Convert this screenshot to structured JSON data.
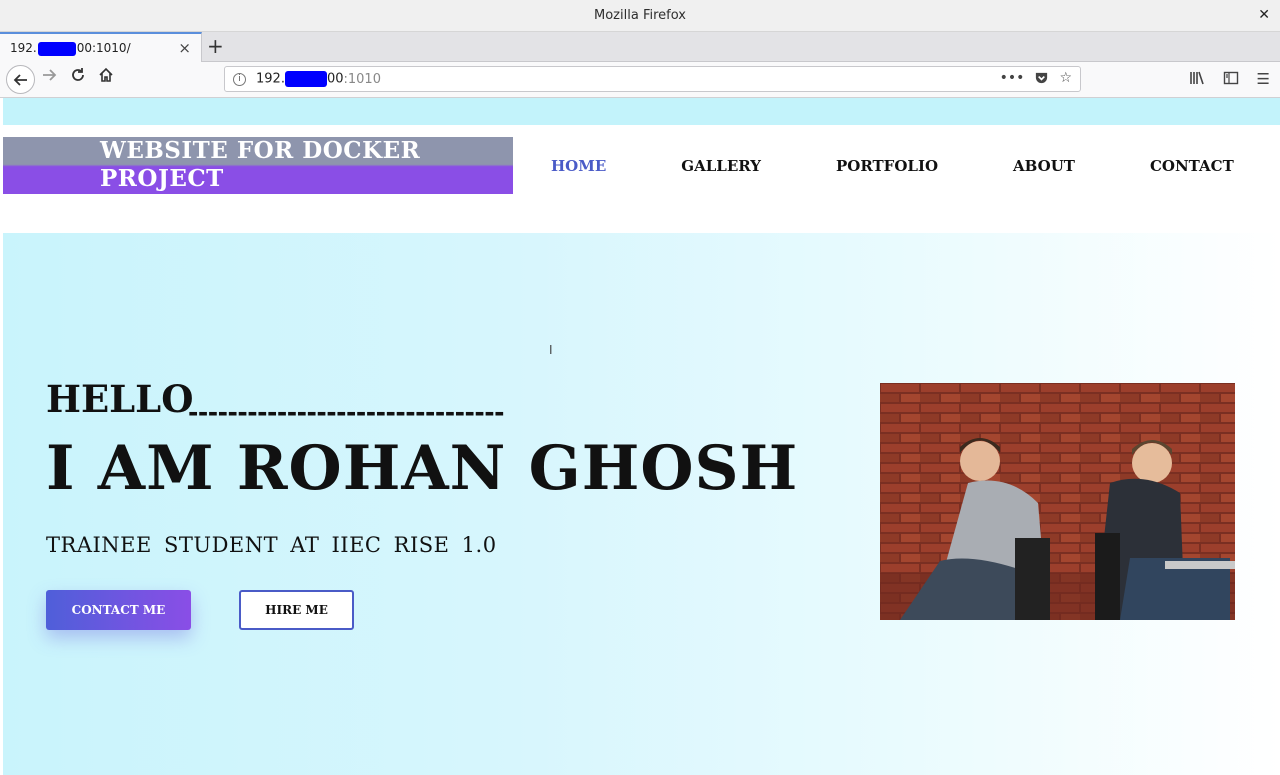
{
  "window": {
    "title": "Mozilla Firefox"
  },
  "tab": {
    "title_prefix": "192.",
    "title_suffix": "00:1010/"
  },
  "urlbar": {
    "host_prefix": "192.",
    "host_suffix": "00",
    "port": ":1010"
  },
  "site": {
    "logo_line1": "WEBSITE FOR DOCKER",
    "logo_line2": "PROJECT",
    "menu": [
      {
        "label": "HOME",
        "active": true
      },
      {
        "label": "GALLERY",
        "active": false
      },
      {
        "label": "PORTFOLIO",
        "active": false
      },
      {
        "label": "ABOUT",
        "active": false
      },
      {
        "label": "CONTACT",
        "active": false
      }
    ]
  },
  "hero": {
    "greeting": "HELLO",
    "dashes": "--------------------------------",
    "name": "I AM ROHAN GHOSH",
    "subtitle": "TRAINEE STUDENT AT IIEC RISE 1.0",
    "contact_button": "CONTACT ME",
    "hire_button": "HIRE ME"
  },
  "colors": {
    "accent": "#4a5bc7",
    "gradient_start": "#4f5fd9",
    "gradient_end": "#8a4ee6",
    "hero_bg": "#c9f4fc"
  },
  "icons": {
    "close": "close-icon",
    "new_tab": "plus-icon",
    "back": "back-arrow-icon",
    "forward": "forward-arrow-icon",
    "reload": "reload-icon",
    "home": "home-icon",
    "info": "info-icon",
    "more": "more-icon",
    "pocket": "pocket-icon",
    "bookmark": "star-icon",
    "library": "library-icon",
    "sidebar": "sidebar-icon",
    "menu": "hamburger-icon"
  }
}
